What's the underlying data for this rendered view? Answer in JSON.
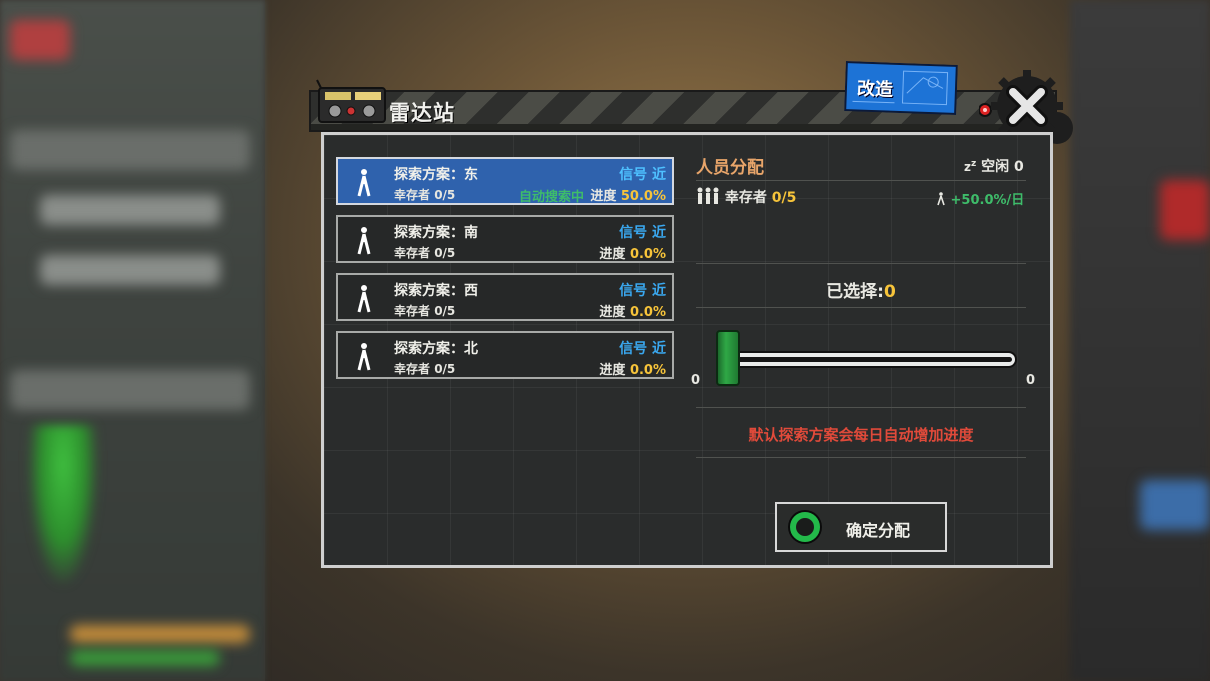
{
  "window": {
    "title": "雷达站",
    "upgrade_label": "改造"
  },
  "plans": [
    {
      "name": "探索方案：东",
      "signal": "信号 近",
      "survivor_label": "幸存者",
      "survivor_value": "0/5",
      "auto_text": "自动搜索中",
      "progress_label": "进度",
      "progress_value": "50.0%",
      "active": true
    },
    {
      "name": "探索方案：南",
      "signal": "信号 近",
      "survivor_label": "幸存者",
      "survivor_value": "0/5",
      "auto_text": "",
      "progress_label": "进度",
      "progress_value": "0.0%",
      "active": false
    },
    {
      "name": "探索方案：西",
      "signal": "信号 近",
      "survivor_label": "幸存者",
      "survivor_value": "0/5",
      "auto_text": "",
      "progress_label": "进度",
      "progress_value": "0.0%",
      "active": false
    },
    {
      "name": "探索方案：北",
      "signal": "信号 近",
      "survivor_label": "幸存者",
      "survivor_value": "0/5",
      "auto_text": "",
      "progress_label": "进度",
      "progress_value": "0.0%",
      "active": false
    }
  ],
  "allocation": {
    "title": "人员分配",
    "idle_label": "空闲",
    "idle_value": "0",
    "survivor_label": "幸存者",
    "survivor_value": "0/5",
    "rate": "+50.0%/日",
    "selected_label": "已选择:",
    "selected_value": "0",
    "slider_min": "0",
    "slider_max": "0",
    "slider_value": 0,
    "note": "默认探索方案会每日自动增加进度",
    "confirm_label": "确定分配"
  },
  "colors": {
    "accent_blue": "#2f62ad",
    "highlight_yellow": "#f7c43a",
    "positive_green": "#3ebc6a",
    "warning_red": "#e04a3a",
    "section_orange": "#e8a56a"
  },
  "icons": {
    "plan_icon": "explorer-walker-icon",
    "survivors_icon": "people-group-icon",
    "idle_icon": "sleep-zz-icon",
    "rate_icon": "walker-icon",
    "window_icon": "radio-device-icon",
    "close_icon": "close-x-gear-icon",
    "confirm_icon": "ring-icon"
  }
}
